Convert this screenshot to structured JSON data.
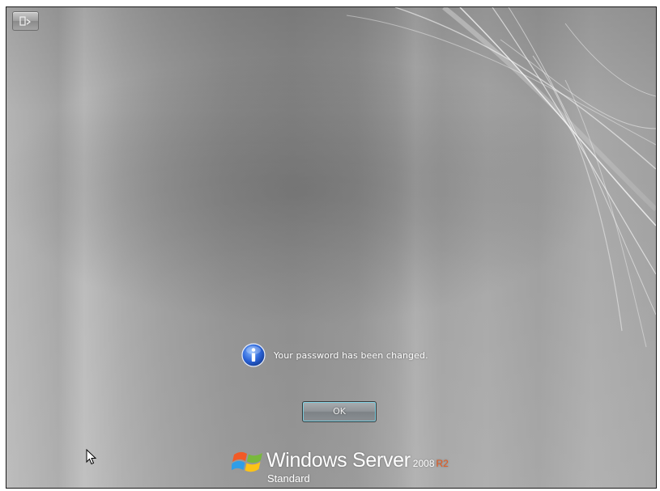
{
  "access_button": {
    "icon": "ease-of-access-icon"
  },
  "message": {
    "icon": "info-icon",
    "text": "Your password has been changed."
  },
  "ok_button": {
    "label": "OK"
  },
  "branding": {
    "product": "Windows Server",
    "version": "2008",
    "release": "R2",
    "edition": "Standard",
    "logo": "windows-flag-logo",
    "release_color": "#e85a1e"
  },
  "cursor": {
    "icon": "mouse-pointer-icon"
  }
}
